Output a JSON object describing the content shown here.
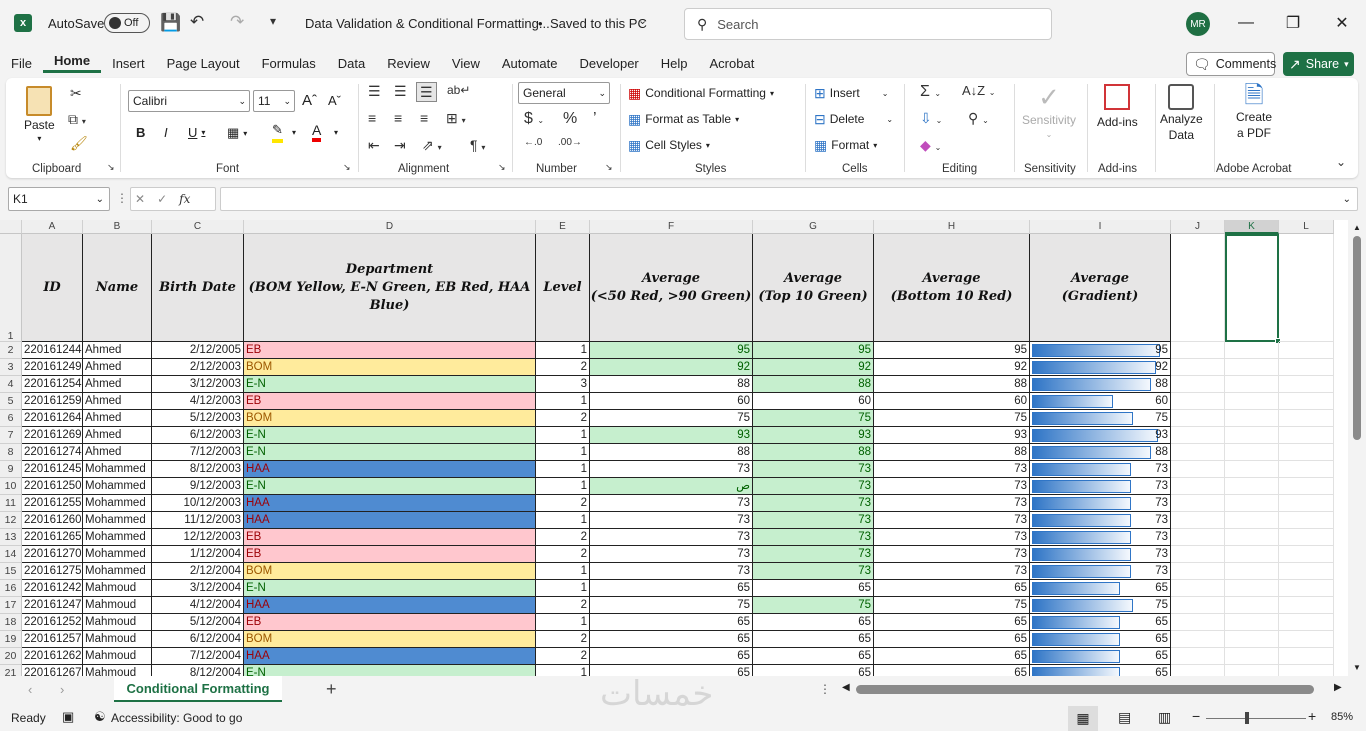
{
  "titlebar": {
    "autosave_label": "AutoSave",
    "autosave_state": "Off",
    "doc_title": "Data Validation & Conditional Formatting...",
    "saved_status": "Saved to this PC",
    "search_placeholder": "Search",
    "user_initials": "MR"
  },
  "menu_tabs": [
    "File",
    "Home",
    "Insert",
    "Page Layout",
    "Formulas",
    "Data",
    "Review",
    "View",
    "Automate",
    "Developer",
    "Help",
    "Acrobat"
  ],
  "active_tab": "Home",
  "actions": {
    "comments": "Comments",
    "share": "Share"
  },
  "ribbon": {
    "clipboard": {
      "paste": "Paste",
      "label": "Clipboard"
    },
    "font": {
      "name": "Calibri",
      "size": "11",
      "label": "Font"
    },
    "alignment": {
      "label": "Alignment"
    },
    "number": {
      "format": "General",
      "label": "Number"
    },
    "styles": {
      "conditional": "Conditional Formatting",
      "format_table": "Format as Table",
      "cell_styles": "Cell Styles",
      "label": "Styles"
    },
    "cells": {
      "insert": "Insert",
      "delete": "Delete",
      "format": "Format",
      "label": "Cells"
    },
    "editing": {
      "label": "Editing"
    },
    "sensitivity": {
      "button": "Sensitivity",
      "label": "Sensitivity"
    },
    "addins": {
      "button": "Add-ins",
      "label": "Add-ins"
    },
    "analyze": {
      "line1": "Analyze",
      "line2": "Data"
    },
    "acrobat": {
      "line1": "Create",
      "line2": "a PDF",
      "label": "Adobe Acrobat"
    }
  },
  "formula_bar": {
    "name_box": "K1",
    "fx": "fx",
    "content": ""
  },
  "columns": [
    "A",
    "B",
    "C",
    "D",
    "E",
    "F",
    "G",
    "H",
    "I",
    "J",
    "K",
    "L"
  ],
  "headers": {
    "id": "ID",
    "name": "Name",
    "birth": "Birth Date",
    "dept_1": "Department",
    "dept_2": "(BOM Yellow, E-N Green, EB Red, HAA Blue)",
    "level": "Level",
    "avgf_1": "Average",
    "avgf_2": "(<50 Red, >90 Green)",
    "avgg_1": "Average",
    "avgg_2": "(Top 10 Green)",
    "avgh_1": "Average",
    "avgh_2": "(Bottom 10 Red)",
    "avgi_1": "Average",
    "avgi_2": "(Gradient)"
  },
  "colors": {
    "EB": "#ffc7ce",
    "BOM": "#ffeb9c",
    "E-N": "#c6efce",
    "HAA": "#4f8bd1",
    "green_fill": "#c6efce",
    "excel_green": "#1e7145"
  },
  "rows": [
    {
      "num": "2",
      "id": "220161244",
      "name": "Ahmed",
      "birth": "2/12/2005",
      "dept": "EB",
      "level": "1",
      "avg": "95",
      "f_green": true,
      "g_green": true,
      "bar": 0.95
    },
    {
      "num": "3",
      "id": "220161249",
      "name": "Ahmed",
      "birth": "2/12/2003",
      "dept": "BOM",
      "level": "2",
      "avg": "92",
      "f_green": true,
      "g_green": true,
      "bar": 0.92
    },
    {
      "num": "4",
      "id": "220161254",
      "name": "Ahmed",
      "birth": "3/12/2003",
      "dept": "E-N",
      "level": "3",
      "avg": "88",
      "f_green": false,
      "g_green": true,
      "bar": 0.88
    },
    {
      "num": "5",
      "id": "220161259",
      "name": "Ahmed",
      "birth": "4/12/2003",
      "dept": "EB",
      "level": "1",
      "avg": "60",
      "f_green": false,
      "g_green": false,
      "bar": 0.6
    },
    {
      "num": "6",
      "id": "220161264",
      "name": "Ahmed",
      "birth": "5/12/2003",
      "dept": "BOM",
      "level": "2",
      "avg": "75",
      "f_green": false,
      "g_green": true,
      "bar": 0.75
    },
    {
      "num": "7",
      "id": "220161269",
      "name": "Ahmed",
      "birth": "6/12/2003",
      "dept": "E-N",
      "level": "1",
      "avg": "93",
      "f_green": true,
      "g_green": true,
      "bar": 0.93
    },
    {
      "num": "8",
      "id": "220161274",
      "name": "Ahmed",
      "birth": "7/12/2003",
      "dept": "E-N",
      "level": "1",
      "avg": "88",
      "f_green": false,
      "g_green": true,
      "bar": 0.88
    },
    {
      "num": "9",
      "id": "220161245",
      "name": "Mohammed",
      "birth": "8/12/2003",
      "dept": "HAA",
      "level": "1",
      "avg": "73",
      "f_green": false,
      "g_green": true,
      "bar": 0.73
    },
    {
      "num": "10",
      "id": "220161250",
      "name": "Mohammed",
      "birth": "9/12/2003",
      "dept": "E-N",
      "level": "1",
      "avg": "73",
      "f_text": "ص",
      "f_green": true,
      "g_green": true,
      "bar": 0.73
    },
    {
      "num": "11",
      "id": "220161255",
      "name": "Mohammed",
      "birth": "10/12/2003",
      "dept": "HAA",
      "level": "2",
      "avg": "73",
      "f_green": false,
      "g_green": true,
      "bar": 0.73
    },
    {
      "num": "12",
      "id": "220161260",
      "name": "Mohammed",
      "birth": "11/12/2003",
      "dept": "HAA",
      "level": "1",
      "avg": "73",
      "f_green": false,
      "g_green": true,
      "bar": 0.73
    },
    {
      "num": "13",
      "id": "220161265",
      "name": "Mohammed",
      "birth": "12/12/2003",
      "dept": "EB",
      "level": "2",
      "avg": "73",
      "f_green": false,
      "g_green": true,
      "bar": 0.73
    },
    {
      "num": "14",
      "id": "220161270",
      "name": "Mohammed",
      "birth": "1/12/2004",
      "dept": "EB",
      "level": "2",
      "avg": "73",
      "f_green": false,
      "g_green": true,
      "bar": 0.73
    },
    {
      "num": "15",
      "id": "220161275",
      "name": "Mohammed",
      "birth": "2/12/2004",
      "dept": "BOM",
      "level": "1",
      "avg": "73",
      "f_green": false,
      "g_green": true,
      "bar": 0.73
    },
    {
      "num": "16",
      "id": "220161242",
      "name": "Mahmoud",
      "birth": "3/12/2004",
      "dept": "E-N",
      "level": "1",
      "avg": "65",
      "f_green": false,
      "g_green": false,
      "bar": 0.65
    },
    {
      "num": "17",
      "id": "220161247",
      "name": "Mahmoud",
      "birth": "4/12/2004",
      "dept": "HAA",
      "level": "2",
      "avg": "75",
      "f_green": false,
      "g_green": true,
      "bar": 0.75
    },
    {
      "num": "18",
      "id": "220161252",
      "name": "Mahmoud",
      "birth": "5/12/2004",
      "dept": "EB",
      "level": "1",
      "avg": "65",
      "f_green": false,
      "g_green": false,
      "bar": 0.65
    },
    {
      "num": "19",
      "id": "220161257",
      "name": "Mahmoud",
      "birth": "6/12/2004",
      "dept": "BOM",
      "level": "2",
      "avg": "65",
      "f_green": false,
      "g_green": false,
      "bar": 0.65
    },
    {
      "num": "20",
      "id": "220161262",
      "name": "Mahmoud",
      "birth": "7/12/2004",
      "dept": "HAA",
      "level": "2",
      "avg": "65",
      "f_green": false,
      "g_green": false,
      "bar": 0.65
    },
    {
      "num": "21",
      "id": "220161267",
      "name": "Mahmoud",
      "birth": "8/12/2004",
      "dept": "E-N",
      "level": "1",
      "avg": "65",
      "f_green": false,
      "g_green": false,
      "bar": 0.65
    }
  ],
  "sheet_tab": "Conditional Formatting",
  "watermark": "خمسات",
  "status": {
    "ready": "Ready",
    "accessibility": "Accessibility: Good to go",
    "zoom": "85%"
  }
}
